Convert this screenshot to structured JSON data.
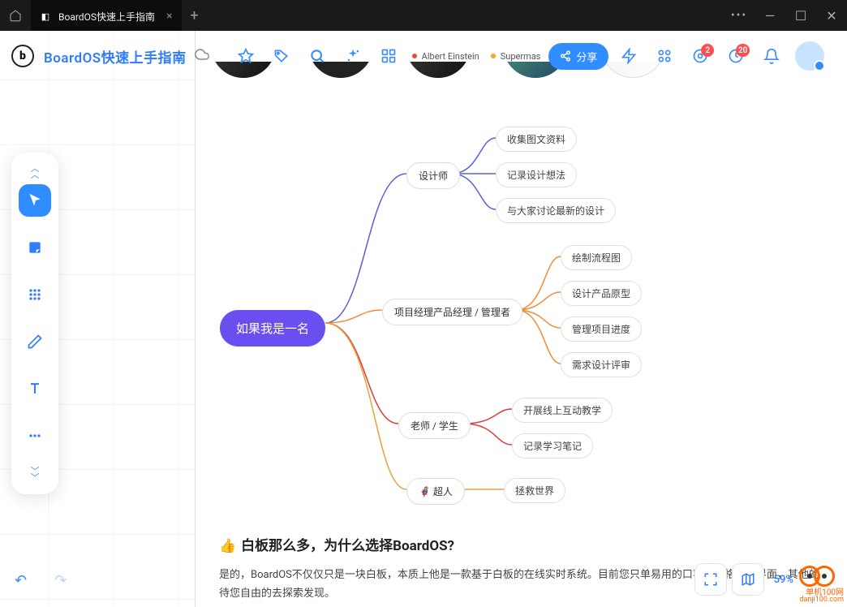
{
  "browser": {
    "tab_title": "BoardOS快速上手指南",
    "close": "×",
    "plus": "+",
    "dots": "•••",
    "minimize": "—",
    "maximize": "☐",
    "close_win": "✕"
  },
  "header": {
    "logo": "b",
    "title": "BoardOS快速上手指南",
    "chips": [
      {
        "color": "#e74c3c",
        "label": "Albert Einstein"
      },
      {
        "color": "#f5a623",
        "label": "Supermas"
      }
    ],
    "share": "分享",
    "badge1": "2",
    "badge2": "20"
  },
  "tools": {
    "labels": [
      "cursor",
      "sticky",
      "grid",
      "pen",
      "text",
      "more"
    ]
  },
  "mindmap": {
    "root": "如果我是一名",
    "b1": {
      "label": "设计师",
      "color": "#5b62d6",
      "leaves": [
        "收集图文资料",
        "记录设计想法",
        "与大家讨论最新的设计"
      ]
    },
    "b2": {
      "label": "项目经理产品经理 / 管理者",
      "color": "#f08c3a",
      "leaves": [
        "绘制流程图",
        "设计产品原型",
        "管理项目进度",
        "需求设计评审"
      ]
    },
    "b3": {
      "label": "老师 / 学生",
      "color": "#e23b3b",
      "leaves": [
        "开展线上互动教学",
        "记录学习笔记"
      ]
    },
    "b4": {
      "label": "🦸 超人",
      "color": "#e8a23c",
      "leaves": [
        "拯救世界"
      ]
    }
  },
  "article": {
    "heading_prefix": "👍",
    "heading": "白板那么多，为什么选择BoardOS?",
    "body": "是的，BoardOS不仅仅只是一块白板，本质上他是一款基于白板的在线实时系统。目前您只单易用的口苹果风格交互界面，其他的待您自由的去探索发现。"
  },
  "footer": {
    "zoom": "59%",
    "watermark_text": "单机100网",
    "watermark_url": "danji100.com"
  }
}
